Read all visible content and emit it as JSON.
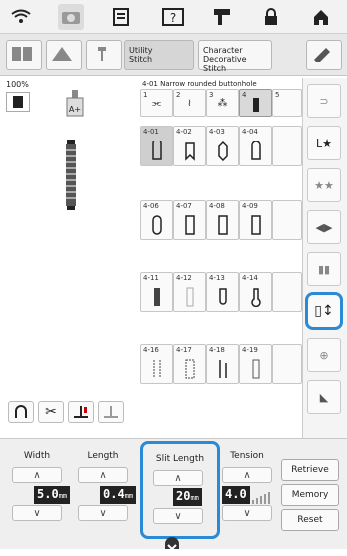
{
  "top_bar": {
    "icons": [
      "wifi-icon",
      "camera-icon",
      "document-icon",
      "help-icon",
      "sewing-icon",
      "lock-icon",
      "home-icon"
    ]
  },
  "mode_bar": {
    "utility_label": "Utility\nStitch",
    "character_label": "Character\nDecorative\nStitch"
  },
  "left_panel": {
    "zoom": "100%"
  },
  "grid": {
    "header_label": "4-01 Narrow rounded buttonhole",
    "tab_numbers": [
      "1",
      "2",
      "3",
      "4",
      "5"
    ],
    "cells": [
      "4-01",
      "4-02",
      "4-03",
      "4-04",
      "4-06",
      "4-07",
      "4-08",
      "4-09",
      "4-11",
      "4-12",
      "4-13",
      "4-14",
      "4-16",
      "4-17",
      "4-18",
      "4-19"
    ]
  },
  "controls": {
    "width": {
      "label": "Width",
      "value": "5.0",
      "unit": "mm"
    },
    "length": {
      "label": "Length",
      "value": "0.4",
      "unit": "mm"
    },
    "slit_length": {
      "label": "Slit Length",
      "value": "20",
      "unit": "mm"
    },
    "tension": {
      "label": "Tension",
      "value": "4.0"
    }
  },
  "buttons": {
    "retrieve": "Retrieve",
    "memory": "Memory",
    "reset": "Reset"
  },
  "colors": {
    "accent": "#2a8ad6"
  }
}
